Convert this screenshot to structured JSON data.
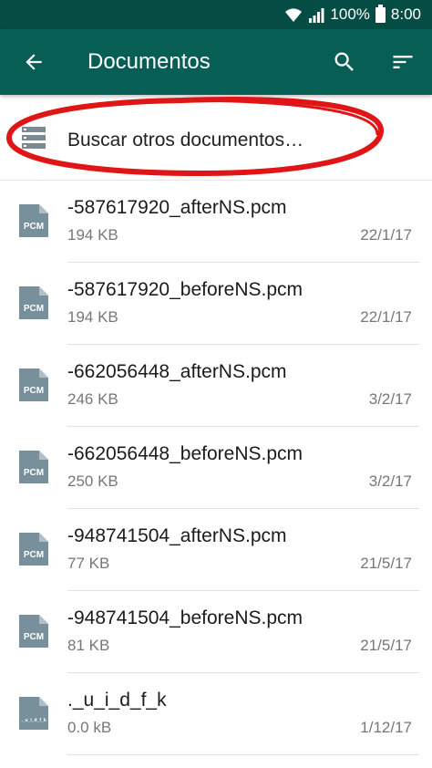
{
  "status_bar": {
    "battery": "100%",
    "time": "8:00"
  },
  "app_bar": {
    "title": "Documentos"
  },
  "search_other": {
    "label": "Buscar otros documentos…"
  },
  "colors": {
    "primary": "#075e54",
    "status": "#054d44",
    "icon_gray": "#78909c",
    "annotation_red": "#e01515"
  },
  "files": [
    {
      "name": "-587617920_afterNS.pcm",
      "size": "194 KB",
      "date": "22/1/17",
      "type": "PCM"
    },
    {
      "name": "-587617920_beforeNS.pcm",
      "size": "194 KB",
      "date": "22/1/17",
      "type": "PCM"
    },
    {
      "name": "-662056448_afterNS.pcm",
      "size": "246 KB",
      "date": "3/2/17",
      "type": "PCM"
    },
    {
      "name": "-662056448_beforeNS.pcm",
      "size": "250 KB",
      "date": "3/2/17",
      "type": "PCM"
    },
    {
      "name": "-948741504_afterNS.pcm",
      "size": "77 KB",
      "date": "21/5/17",
      "type": "PCM"
    },
    {
      "name": "-948741504_beforeNS.pcm",
      "size": "81 KB",
      "date": "21/5/17",
      "type": "PCM"
    },
    {
      "name": "._u_i_d_f_k",
      "size": "0.0 kB",
      "date": "1/12/17",
      "type": "._u_i_d_f_k"
    }
  ]
}
